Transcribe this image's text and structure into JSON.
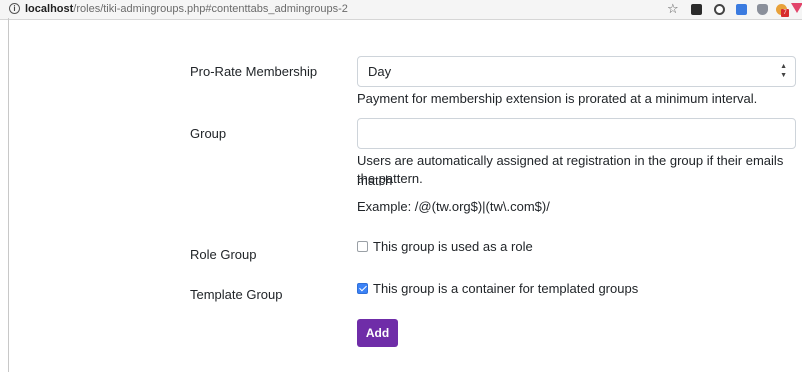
{
  "browser": {
    "url_host": "localhost",
    "url_path": "/roles/tiki-admingroups.php#contenttabs_admingroups-2",
    "icons": [
      "info-icon",
      "star-icon",
      "extension-icons"
    ],
    "extension_badge": "7"
  },
  "form": {
    "prorate": {
      "label": "Pro-Rate Membership",
      "selected": "Day",
      "help": "Payment for membership extension is prorated at a minimum interval."
    },
    "group": {
      "label": "Group",
      "value": "",
      "help_line1": "Users are automatically assigned at registration in the group if their emails match",
      "help_line2": "the pattern.",
      "example": "Example: /@(tw.org$)|(tw\\.com$)/"
    },
    "role_group": {
      "label": "Role Group",
      "checkbox_label": "This group is used as a role",
      "checked": false
    },
    "template_group": {
      "label": "Template Group",
      "checkbox_label": "This group is a container for templated groups",
      "checked": true
    },
    "submit_label": "Add"
  },
  "colors": {
    "accent": "#6f2da8",
    "checkbox_checked": "#3b82f6"
  }
}
